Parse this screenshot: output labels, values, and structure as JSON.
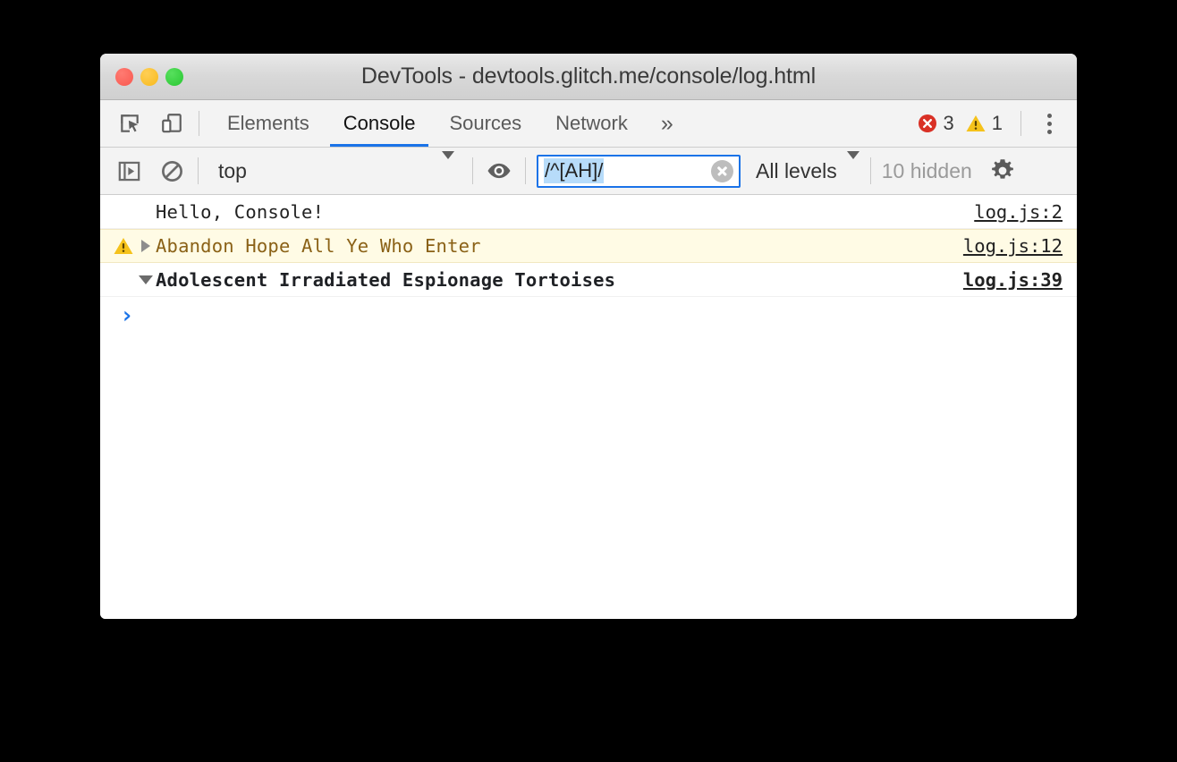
{
  "window": {
    "title": "DevTools - devtools.glitch.me/console/log.html",
    "traffic_lights": [
      "close-button",
      "minimize-button",
      "maximize-button"
    ]
  },
  "tabbar": {
    "inspect_icon": "inspect-element-icon",
    "device_icon": "device-toolbar-icon",
    "tabs": [
      {
        "label": "Elements",
        "active": false
      },
      {
        "label": "Console",
        "active": true
      },
      {
        "label": "Sources",
        "active": false
      },
      {
        "label": "Network",
        "active": false
      }
    ],
    "more_tabs_label": "»",
    "error_count": "3",
    "warning_count": "1",
    "error_icon": "error-circle-icon",
    "warning_icon": "warning-triangle-icon",
    "menu_icon": "kebab-menu-icon"
  },
  "console_toolbar": {
    "sidebar_icon": "console-sidebar-icon",
    "clear_icon": "clear-console-icon",
    "context_value": "top",
    "context_caret": "chevron-down-icon",
    "eye_icon": "live-expression-eye-icon",
    "filter_value": "/^[AH]/",
    "filter_placeholder": "Filter",
    "filter_clear_icon": "clear-input-icon",
    "levels_label": "All levels",
    "levels_caret": "chevron-down-icon",
    "hidden_label": "10 hidden",
    "settings_icon": "gear-icon"
  },
  "console_messages": [
    {
      "level": "log",
      "icon": "",
      "disclosure": "",
      "text": "Hello, Console!",
      "source": "log.js:2"
    },
    {
      "level": "warning",
      "icon": "warning-triangle-icon",
      "disclosure": "triangle-right",
      "text": "Abandon Hope All Ye Who Enter",
      "source": "log.js:12"
    },
    {
      "level": "group",
      "icon": "",
      "disclosure": "triangle-down",
      "text": "Adolescent Irradiated Espionage Tortoises",
      "source": "log.js:39"
    }
  ],
  "prompt": {
    "chevron": "›",
    "value": ""
  },
  "colors": {
    "accent_blue": "#1a73e8",
    "warning_bg": "#fffbe5",
    "warning_text": "#8a6116",
    "error_red": "#d93025",
    "warning_yellow": "#f5c21b",
    "toolbar_bg": "#f3f3f3",
    "titlebar_bg": "#d8d8d8",
    "selection_blue": "#b7dcfa"
  }
}
